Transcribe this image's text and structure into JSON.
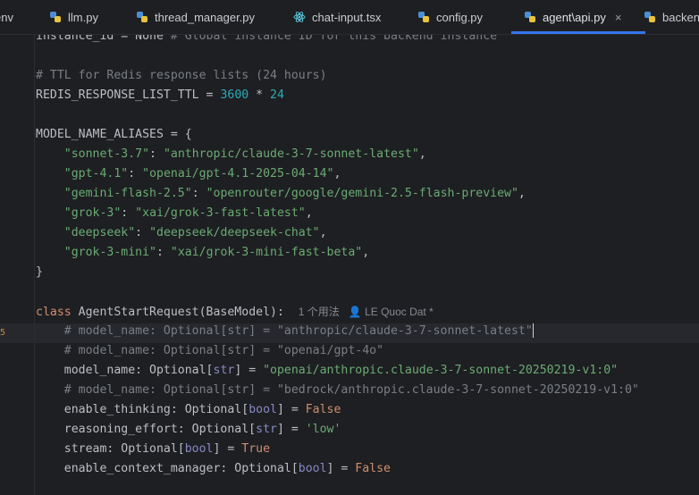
{
  "tabs": [
    {
      "label": "env",
      "icon": "env-file-icon"
    },
    {
      "label": "llm.py",
      "icon": "python-icon"
    },
    {
      "label": "thread_manager.py",
      "icon": "python-icon"
    },
    {
      "label": "chat-input.tsx",
      "icon": "react-icon"
    },
    {
      "label": "config.py",
      "icon": "python-icon"
    },
    {
      "label": "agent\\api.py",
      "icon": "python-icon",
      "active": true,
      "close": "×"
    },
    {
      "label": "backen",
      "icon": "python-icon"
    }
  ],
  "code_lines": [
    [
      [
        "t",
        "instance_id = None "
      ],
      [
        "c",
        "# Global instance ID for this backend instance"
      ]
    ],
    [],
    [
      [
        "c",
        "# TTL for Redis response lists (24 hours)"
      ]
    ],
    [
      [
        "t",
        "REDIS_RESPONSE_LIST_TTL = "
      ],
      [
        "n",
        "3600"
      ],
      [
        "t",
        " * "
      ],
      [
        "n",
        "24"
      ]
    ],
    [],
    [
      [
        "t",
        "MODEL_NAME_ALIASES = {"
      ]
    ],
    [
      [
        "t",
        "    "
      ],
      [
        "s",
        "\"sonnet-3.7\""
      ],
      [
        "t",
        ": "
      ],
      [
        "s",
        "\"anthropic/claude-3-7-sonnet-latest\""
      ],
      [
        "t",
        ","
      ]
    ],
    [
      [
        "t",
        "    "
      ],
      [
        "s",
        "\"gpt-4.1\""
      ],
      [
        "t",
        ": "
      ],
      [
        "s",
        "\"openai/gpt-4.1-2025-04-14\""
      ],
      [
        "t",
        ","
      ]
    ],
    [
      [
        "t",
        "    "
      ],
      [
        "s",
        "\"gemini-flash-2.5\""
      ],
      [
        "t",
        ": "
      ],
      [
        "s",
        "\"openrouter/google/gemini-2.5-flash-preview\""
      ],
      [
        "t",
        ","
      ]
    ],
    [
      [
        "t",
        "    "
      ],
      [
        "s",
        "\"grok-3\""
      ],
      [
        "t",
        ": "
      ],
      [
        "s",
        "\"xai/grok-3-fast-latest\""
      ],
      [
        "t",
        ","
      ]
    ],
    [
      [
        "t",
        "    "
      ],
      [
        "s",
        "\"deepseek\""
      ],
      [
        "t",
        ": "
      ],
      [
        "s",
        "\"deepseek/deepseek-chat\""
      ],
      [
        "t",
        ","
      ]
    ],
    [
      [
        "t",
        "    "
      ],
      [
        "s",
        "\"grok-3-mini\""
      ],
      [
        "t",
        ": "
      ],
      [
        "s",
        "\"xai/grok-3-mini-fast-beta\""
      ],
      [
        "t",
        ","
      ]
    ],
    [
      [
        "t",
        "}"
      ]
    ],
    [],
    [
      [
        "k",
        "class "
      ],
      [
        "t",
        "AgentStartRequest(BaseModel):  "
      ],
      [
        "hint",
        "1 个用法   👤 LE Quoc Dat *"
      ]
    ],
    [
      [
        "t",
        "    "
      ],
      [
        "c",
        "# model_name: Optional[str] = \"anthropic/claude-3-7-sonnet-latest\""
      ],
      [
        "caret",
        ""
      ]
    ],
    [
      [
        "t",
        "    "
      ],
      [
        "c",
        "# model_name: Optional[str] = \"openai/gpt-4o\""
      ]
    ],
    [
      [
        "t",
        "    model_name: Optional["
      ],
      [
        "b",
        "str"
      ],
      [
        "t",
        "] = "
      ],
      [
        "s",
        "\"openai/anthropic.claude-3-7-sonnet-20250219-v1:0\""
      ]
    ],
    [
      [
        "t",
        "    "
      ],
      [
        "c",
        "# model_name: Optional[str] = \"bedrock/anthropic.claude-3-7-sonnet-20250219-v1:0\""
      ]
    ],
    [
      [
        "t",
        "    enable_thinking: Optional["
      ],
      [
        "b",
        "bool"
      ],
      [
        "t",
        "] = "
      ],
      [
        "k",
        "False"
      ]
    ],
    [
      [
        "t",
        "    reasoning_effort: Optional["
      ],
      [
        "b",
        "str"
      ],
      [
        "t",
        "] = "
      ],
      [
        "s",
        "'low'"
      ]
    ],
    [
      [
        "t",
        "    stream: Optional["
      ],
      [
        "b",
        "bool"
      ],
      [
        "t",
        "] = "
      ],
      [
        "k",
        "True"
      ]
    ],
    [
      [
        "t",
        "    enable_context_manager: Optional["
      ],
      [
        "b",
        "bool"
      ],
      [
        "t",
        "] = "
      ],
      [
        "k",
        "False"
      ]
    ]
  ]
}
